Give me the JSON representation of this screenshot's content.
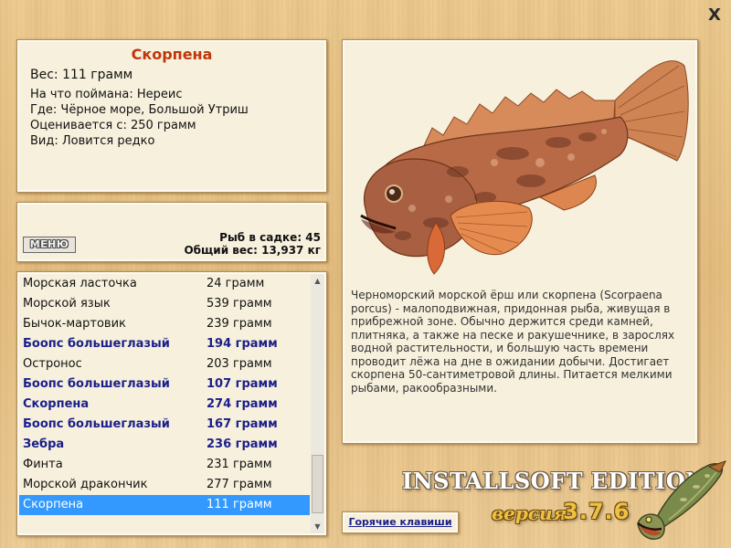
{
  "window": {
    "close_label": "X"
  },
  "info": {
    "title": "Скорпена",
    "weight": "Вес: 111 грамм",
    "bait": "На что поймана: Нереис",
    "location": "Где: Чёрное море, Большой Утриш",
    "valued_from": "Оценивается с: 250 грамм",
    "kind": "Вид: Ловится редко"
  },
  "stats": {
    "menu_label": "МЕНЮ",
    "fish_in_net": "Рыб в садке: 45",
    "total_weight": "Общий вес: 13,937 кг"
  },
  "catch_list": [
    {
      "name": "Морская ласточка",
      "weight": "24 грамм",
      "bold": false,
      "selected": false
    },
    {
      "name": "Морской язык",
      "weight": "539 грамм",
      "bold": false,
      "selected": false
    },
    {
      "name": "Бычок-мартовик",
      "weight": "239 грамм",
      "bold": false,
      "selected": false
    },
    {
      "name": "Боопс большеглазый",
      "weight": "194 грамм",
      "bold": true,
      "selected": false
    },
    {
      "name": "Остронос",
      "weight": "203 грамм",
      "bold": false,
      "selected": false
    },
    {
      "name": "Боопс большеглазый",
      "weight": "107 грамм",
      "bold": true,
      "selected": false
    },
    {
      "name": "Скорпена",
      "weight": "274 грамм",
      "bold": true,
      "selected": false
    },
    {
      "name": "Боопс большеглазый",
      "weight": "167 грамм",
      "bold": true,
      "selected": false
    },
    {
      "name": "Зебра",
      "weight": "236 грамм",
      "bold": true,
      "selected": false
    },
    {
      "name": "Финта",
      "weight": "231 грамм",
      "bold": false,
      "selected": false
    },
    {
      "name": "Морской дракончик",
      "weight": "277 грамм",
      "bold": false,
      "selected": false
    },
    {
      "name": "Скорпена",
      "weight": "111 грамм",
      "bold": false,
      "selected": true
    }
  ],
  "description": {
    "text": "Черноморский морской ёрш или скорпена (Scorpaena porcus) - малоподвижная, придонная рыба, живущая в прибрежной зоне. Обычно держится среди камней, плитняка, а также на песке и ракушечнике, в зарослях водной растительности, и большую часть времени проводит лёжа на дне в ожидании добычи. Достигает скорпена 50-сантиметровой длины. Питается мелкими рыбами, ракообразными."
  },
  "footer": {
    "hotkeys_label": "Горячие клавиши",
    "edition": "INSTALLSOFT EDITION",
    "version_word": "версия",
    "version_number": "3.7.6"
  },
  "icons": {
    "fish_image": "scorpionfish-illustration",
    "logo": "pike-fish-logo",
    "scroll_up": "scroll-up-arrow",
    "scroll_down": "scroll-down-arrow"
  },
  "colors": {
    "title": "#c0360c",
    "highlight_row": "#3399ff",
    "bold_row_text": "#1a1f8c",
    "panel_bg": "#f7f0dc",
    "version_gold": "#f0c040"
  }
}
